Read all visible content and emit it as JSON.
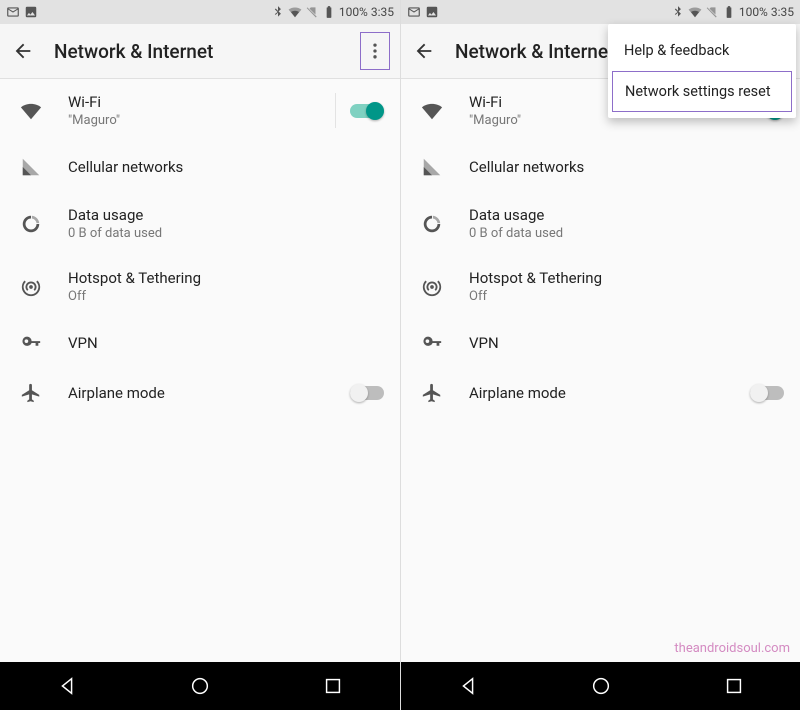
{
  "status": {
    "battery": "100%",
    "time": "3:35"
  },
  "header": {
    "title": "Network & Internet"
  },
  "rows": {
    "wifi": {
      "title": "Wi-Fi",
      "sub": "\"Maguro\""
    },
    "cellular": {
      "title": "Cellular networks"
    },
    "data": {
      "title": "Data usage",
      "sub": "0 B of data used"
    },
    "hotspot": {
      "title": "Hotspot & Tethering",
      "sub": "Off"
    },
    "vpn": {
      "title": "VPN"
    },
    "airplane": {
      "title": "Airplane mode"
    }
  },
  "menu": {
    "help": "Help & feedback",
    "reset": "Network settings reset"
  },
  "watermark": "theandroidsoul.com"
}
